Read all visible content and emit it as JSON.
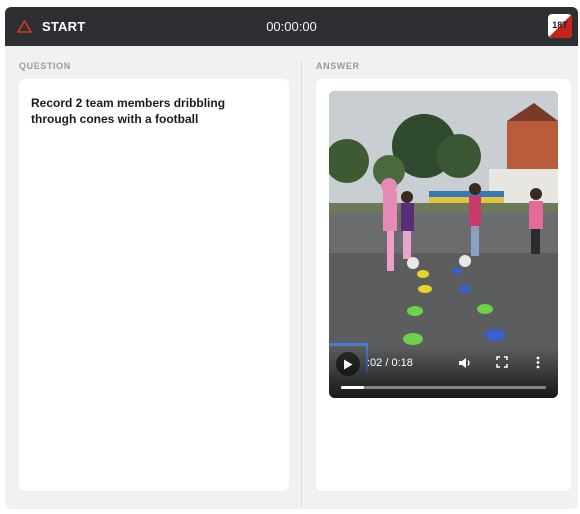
{
  "header": {
    "start_label": "START",
    "timer": "00:00:00",
    "logo_text": "18T"
  },
  "question": {
    "section_label": "QUESTION",
    "text": "Record 2 team members dribbling through cones with a football"
  },
  "answer": {
    "section_label": "ANSWER",
    "video": {
      "time_display": ":02 / 0:18",
      "progress_fraction": 0.11
    }
  },
  "colors": {
    "topbar": "#2e2f33",
    "accent_red": "#c5241c"
  },
  "icons": [
    "warning-triangle-icon",
    "play-icon",
    "volume-icon",
    "fullscreen-icon",
    "more-options-icon"
  ]
}
